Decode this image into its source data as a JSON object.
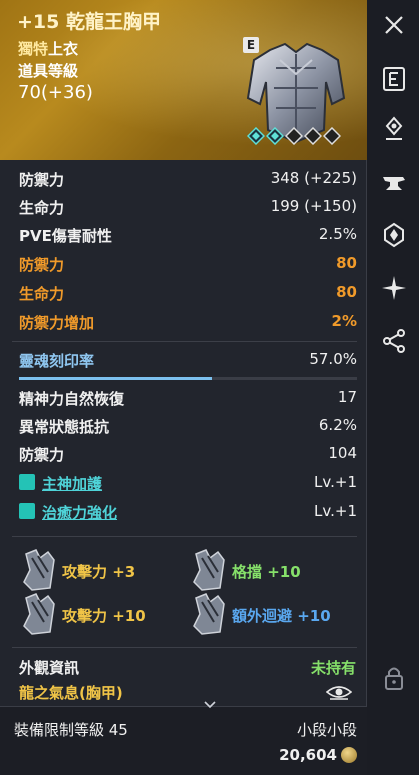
{
  "item": {
    "name": "+15 乾龍王胸甲",
    "grade": "獨特",
    "slot": "上衣",
    "level_label": "道具等級",
    "level_value": "70(+36)",
    "badge": "E"
  },
  "stats": [
    {
      "label": "防禦力",
      "value": "348 (+225)"
    },
    {
      "label": "生命力",
      "value": "199 (+150)"
    },
    {
      "label": "PVE傷害耐性",
      "value": "2.5%"
    },
    {
      "label": "防禦力",
      "value": "80",
      "style": "orange"
    },
    {
      "label": "生命力",
      "value": "80",
      "style": "orange"
    },
    {
      "label": "防禦力增加",
      "value": "2%",
      "style": "orange"
    }
  ],
  "soul": {
    "label": "靈魂刻印率",
    "value": "57.0%",
    "progress": 0.57
  },
  "soul_stats": [
    {
      "label": "精神力自然恢復",
      "value": "17"
    },
    {
      "label": "異常狀態抵抗",
      "value": "6.2%"
    },
    {
      "label": "防禦力",
      "value": "104"
    }
  ],
  "skills": [
    {
      "label": "主神加護",
      "value": "Lv.+1"
    },
    {
      "label": "治癒力強化",
      "value": "Lv.+1"
    }
  ],
  "bonuses": [
    {
      "text": "攻擊力 +3",
      "color": "gold"
    },
    {
      "text": "格擋 +10",
      "color": "green"
    },
    {
      "text": "攻擊力 +10",
      "color": "gold"
    },
    {
      "text": "額外迴避 +10",
      "color": "blue"
    }
  ],
  "appearance": {
    "label": "外觀資訊",
    "value": "未持有",
    "name": "龍之氣息(胸甲)"
  },
  "footer": {
    "requirement": "裝備限制等級 45",
    "grade": "小段小段",
    "price": "20,604"
  },
  "colors": {
    "orange": "#f09a2a",
    "gold": "#f0c447",
    "green": "#86e06a",
    "blue": "#5aa8f0",
    "teal": "#4fd3d8"
  },
  "side_icons": [
    "close-icon",
    "equipment-card-icon",
    "location-pin-icon",
    "anvil-icon",
    "crystal-icon",
    "sparkle-icon",
    "share-icon",
    "lock-icon"
  ]
}
